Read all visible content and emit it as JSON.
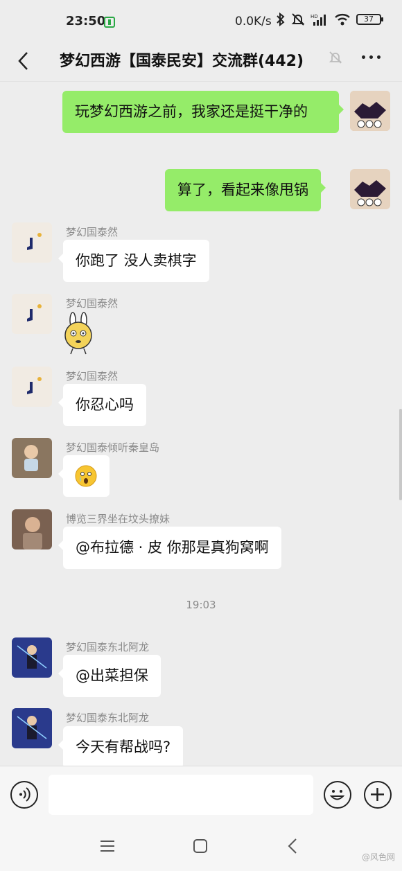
{
  "status_bar": {
    "time": "23:50",
    "net_speed": "0.0K/s",
    "battery": "37"
  },
  "header": {
    "title": "梦幻西游【国泰民安】交流群(442)"
  },
  "messages": [
    {
      "direction": "out",
      "text": "玩梦幻西游之前，我家还是挺干净的"
    },
    {
      "direction": "out",
      "text": "算了，看起来像甩锅"
    },
    {
      "direction": "in",
      "sender": "梦幻国泰然",
      "text": "你跑了 没人卖棋字"
    },
    {
      "direction": "in",
      "sender": "梦幻国泰然",
      "type": "sticker",
      "sticker": "rabbit-sticker"
    },
    {
      "direction": "in",
      "sender": "梦幻国泰然",
      "text": "你忍心吗"
    },
    {
      "direction": "in",
      "sender": "梦幻国泰倾听秦皇岛",
      "type": "emoji",
      "emoji": "crying-emoji"
    },
    {
      "direction": "in",
      "sender": "博览三界坐在坟头撩妹",
      "text": "@布拉德 · 皮  你那是真狗窝啊"
    },
    {
      "direction": "in",
      "sender": "梦幻国泰东北阿龙",
      "text": "@出菜担保"
    },
    {
      "direction": "in",
      "sender": "梦幻国泰东北阿龙",
      "text": "今天有帮战吗?"
    }
  ],
  "timestamp_divider": "19:03",
  "input": {
    "value": "",
    "placeholder": ""
  },
  "watermark": "@风色网",
  "colors": {
    "background": "#ededed",
    "outgoing_bubble": "#95ec69",
    "incoming_bubble": "#ffffff",
    "sender_name": "#8a8a8a"
  }
}
